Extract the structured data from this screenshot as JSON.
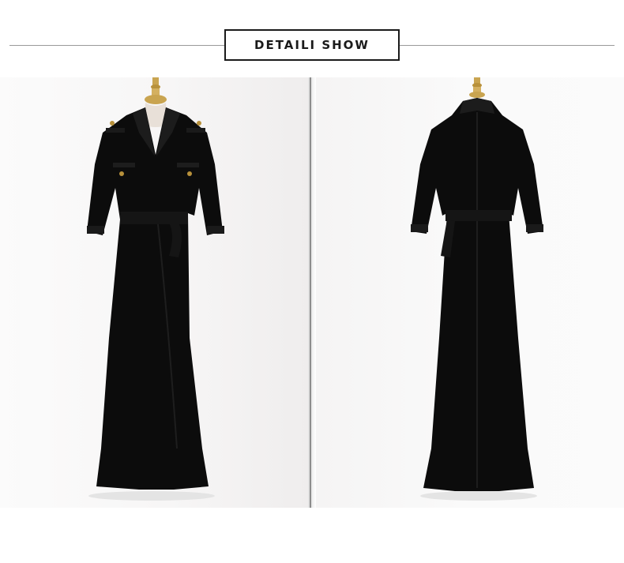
{
  "header": {
    "title": "DETAILI SHOW"
  },
  "photos": [
    {
      "view": "front",
      "subject": "black-wrap-maxi-dress"
    },
    {
      "view": "back",
      "subject": "black-wrap-maxi-dress"
    }
  ],
  "colors": {
    "dress": "#0c0c0c",
    "background": "#ffffff",
    "rule": "#9a9a9a",
    "frame": "#1a1a1a",
    "mannequin_brass": "#c9a450"
  }
}
